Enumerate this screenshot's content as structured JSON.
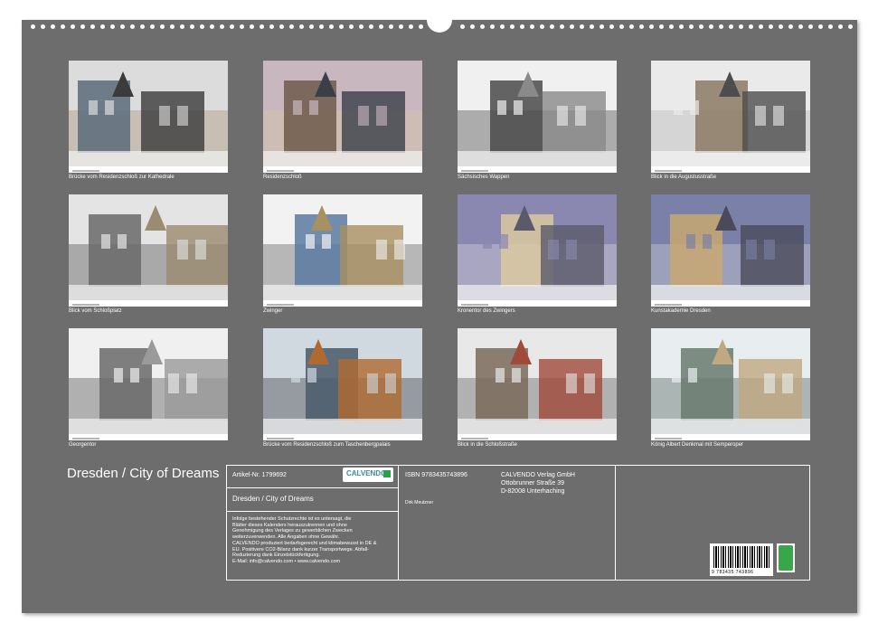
{
  "calendar_title": "Dresden / City of Dreams",
  "photos": [
    {
      "caption": "Brücke vom Residenzschloß zur Kathedrale"
    },
    {
      "caption": "Residenzschloß"
    },
    {
      "caption": "Sächsisches Wappen"
    },
    {
      "caption": "Blick in die Augustusstraße"
    },
    {
      "caption": "Blick vom Schloßplatz"
    },
    {
      "caption": "Zwinger"
    },
    {
      "caption": "Kronentor des Zwingers"
    },
    {
      "caption": "Kunstakademie Dresden"
    },
    {
      "caption": "Georgentor"
    },
    {
      "caption": "Brücke vom Residenzschloß zum Taschenbergpalais"
    },
    {
      "caption": "Blick in die Schloßstraße"
    },
    {
      "caption": "König Albert Denkmal mit Semperoper"
    }
  ],
  "info": {
    "article_number": "Artikel-Nr. 1799692",
    "logo_text": "CALVENDO",
    "isbn": "ISBN 9783435743896",
    "publisher_lines": [
      "CALVENDO Verlag GmbH",
      "Ottobrunner Straße 39",
      "D-82008 Unterhaching"
    ],
    "product_title": "Dresden / City of Dreams",
    "author": "Dirk Meutzner",
    "legal_text": [
      "Infolge bestehender Schutzrechte ist es untersagt, die",
      "Blätter dieses Kalenders herauszutrennen und ohne",
      "Genehmigung des Verlages zu gewerblichen Zwecken",
      "weiterzuverwenden. Alle Angaben ohne Gewähr.",
      "CALVENDO produziert bedarfsgerecht und klimabewusst in DE &",
      "EU. Positivere CO2-Bilanz dank kurzer Transportwege. Abfall-",
      "Reduzierung dank Einzelstückfertigung.",
      "E-Mail: info@calvendo.com • www.calvendo.com"
    ],
    "barcode_number": "9 783435 743896",
    "eco_label": "eco"
  }
}
